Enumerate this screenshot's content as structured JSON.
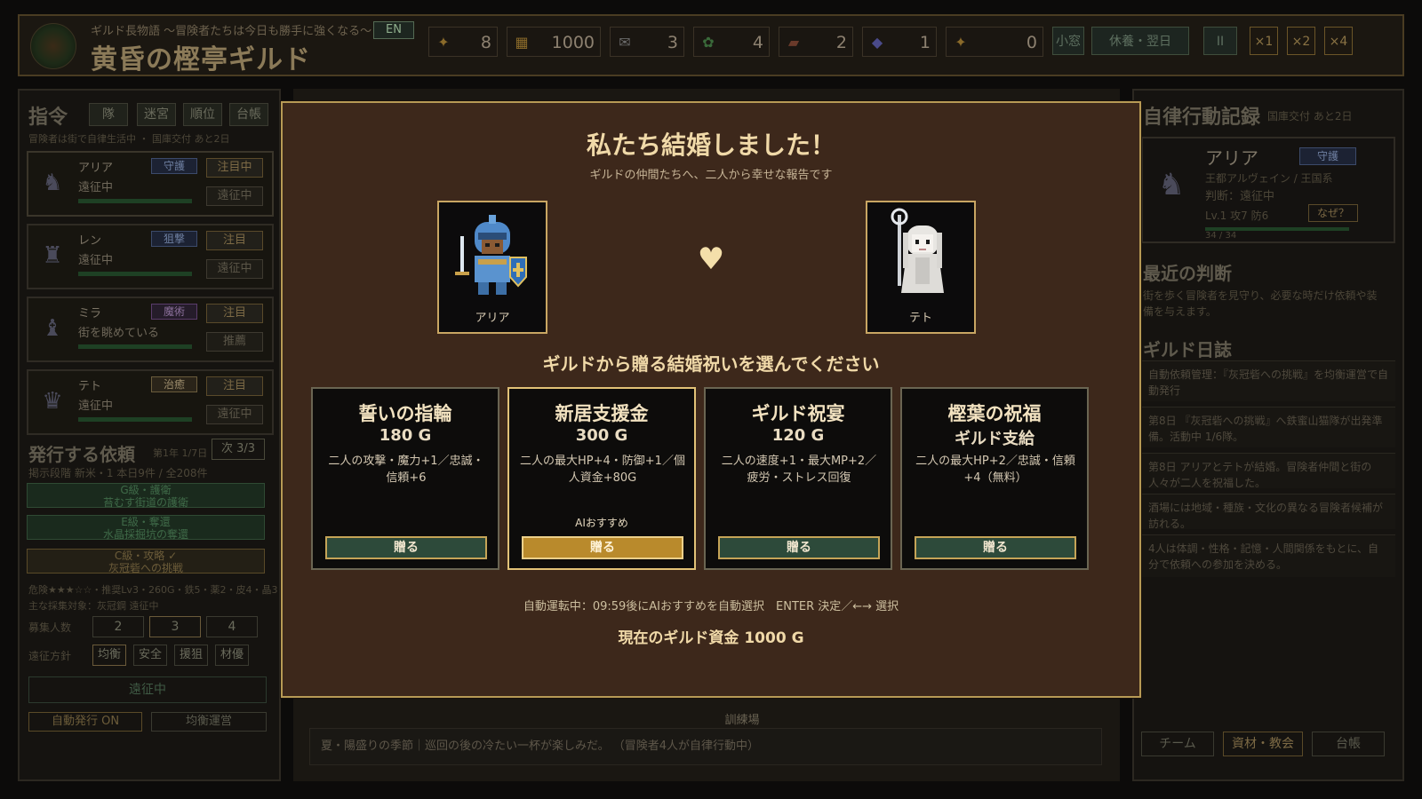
{
  "header": {
    "subtitle": "ギルド長物語 〜冒険者たちは今日も勝手に強くなる〜",
    "title": "黄昏の樫亭ギルド",
    "lang": "EN",
    "resources": [
      {
        "icon": "✦",
        "value": "8"
      },
      {
        "icon": "▦",
        "value": "1000"
      },
      {
        "icon": "✉",
        "value": "3"
      },
      {
        "icon": "✿",
        "value": "4"
      },
      {
        "icon": "▰",
        "value": "2"
      },
      {
        "icon": "◆",
        "value": "1"
      },
      {
        "icon": "✦",
        "value": "0"
      }
    ],
    "small_window": "小窓",
    "rest_next_day": "休養・翌日",
    "pause": "II",
    "speed1": "×1",
    "speed2": "×2",
    "speed4": "×4"
  },
  "left": {
    "heading": "指令",
    "tabs": [
      "隊",
      "迷宮",
      "順位",
      "台帳"
    ],
    "status": "冒険者は街で自律生活中 ・ 国庫交付 あと2日",
    "adventurers": [
      {
        "name": "アリア",
        "role": "守護",
        "state": "遠征中",
        "btn1": "注目中",
        "btn2": "遠征中",
        "avatar": "♞"
      },
      {
        "name": "レン",
        "role": "狙撃",
        "state": "遠征中",
        "btn1": "注目",
        "btn2": "遠征中",
        "avatar": "♜"
      },
      {
        "name": "ミラ",
        "role": "魔術",
        "state": "街を眺めている",
        "btn1": "注目",
        "btn2": "推薦",
        "avatar": "♝"
      },
      {
        "name": "テト",
        "role": "治癒",
        "state": "遠征中",
        "btn1": "注目",
        "btn2": "遠征中",
        "avatar": "♛"
      }
    ],
    "quest_heading": "発行する依頼",
    "quest_meta": "第1年 1/7日",
    "quest_next": "次 3/3",
    "quest_info": "掲示段階 新米・1 本日9件 / 全208件",
    "quests": [
      {
        "rank": "G級・護衛",
        "name": "苔むす街道の護衛"
      },
      {
        "rank": "E級・奪還",
        "name": "水晶採掘坑の奪還"
      },
      {
        "rank": "C級・攻略 ✓",
        "name": "灰冠砦への挑戦"
      }
    ],
    "danger": "危険★★★☆☆・推奨Lv3・260G・鉄5・薬2・皮4・晶3",
    "target": "主な採集対象：灰冠鋼 遠征中",
    "recruit_label": "募集人数",
    "recruit": [
      "2",
      "3",
      "4"
    ],
    "policy_label": "遠征方針",
    "policies": [
      "均衡",
      "安全",
      "援狙",
      "材優"
    ],
    "expedition": "遠征中",
    "auto_issue": "自動発行 ON",
    "balanced": "均衡運営"
  },
  "right": {
    "heading": "自律行動記録",
    "treasury": "国庫交付 あと2日",
    "name": "アリア",
    "role": "守護",
    "origin": "王都アルヴェイン / 王国系",
    "judgement": "判断：遠征中",
    "stats": "Lv.1 攻7 防6",
    "why": "なぜ？",
    "hp": "34 / 34",
    "recent_heading": "最近の判断",
    "recent_text": "街を歩く冒険者を見守り、必要な時だけ依頼や装備を与えます。",
    "journal_heading": "ギルド日誌",
    "journal": [
      "自動依頼管理：『灰冠砦への挑戦』を均衡運営で自動発行",
      "第8日 『灰冠砦への挑戦』へ鉄蜜山猫隊が出発準備。活動中 1/6隊。",
      "第8日 アリアとテトが結婚。冒険者仲間と街の人々が二人を祝福した。",
      "酒場には地域・種族・文化の異なる冒険者候補が訪れる。",
      "4人は体調・性格・記憶・人間関係をもとに、自分で依頼への参加を決める。"
    ],
    "btn_team": "チーム",
    "btn_material": "資材・教会",
    "btn_ledger": "台帳"
  },
  "center": {
    "training": "訓練場",
    "message": "夏・陽盛りの季節｜巡回の後の冷たい一杯が楽しみだ。 （冒険者4人が自律行動中）"
  },
  "modal": {
    "title": "私たち結婚しました！",
    "subtitle": "ギルドの仲間たちへ、二人から幸せな報告です",
    "left_name": "アリア",
    "right_name": "テト",
    "heart": "♥",
    "question": "ギルドから贈る結婚祝いを選んでください",
    "options": [
      {
        "name": "誓いの指輪",
        "price": "180 G",
        "desc": "二人の攻撃・魔力+1／忠誠・信頼+6",
        "rec": "",
        "give": "贈る"
      },
      {
        "name": "新居支援金",
        "price": "300 G",
        "desc": "二人の最大HP+4・防御+1／個人資金+80G",
        "rec": "AIおすすめ",
        "give": "贈る"
      },
      {
        "name": "ギルド祝宴",
        "price": "120 G",
        "desc": "二人の速度+1・最大MP+2／疲労・ストレス回復",
        "rec": "",
        "give": "贈る"
      },
      {
        "name": "樫葉の祝福",
        "price": "ギルド支給",
        "desc": "二人の最大HP+2／忠誠・信頼+4（無料）",
        "rec": "",
        "give": "贈る"
      }
    ],
    "auto": "自動運転中：09:59後にAIおすすめを自動選択　ENTER 決定／←→ 選択",
    "funds": "現在のギルド資金 1000 G"
  }
}
